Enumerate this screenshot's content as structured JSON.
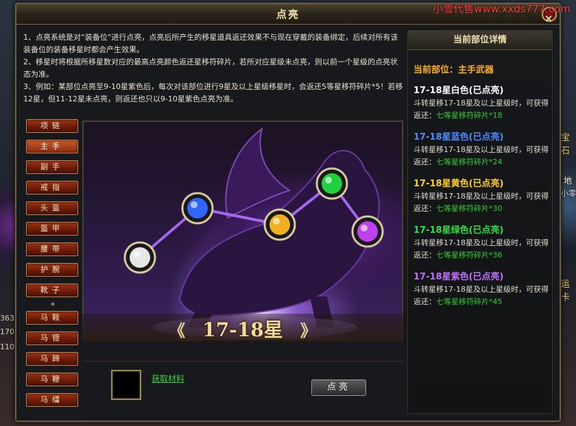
{
  "watermark": "小雪代售www.xxds777.com",
  "window": {
    "title": "点亮",
    "close_label": "×"
  },
  "rules": [
    "1、点亮系统是对“装备位”进行点亮，点亮后所产生的移星道具返还效果不与现在穿戴的装备绑定，后续对所有该装备位的装备移星时都会产生效果。",
    "2、移星时将根据所移星数对应的最高点亮颜色返还星移符碎片，若所对应星级未点亮，则以前一个星级的点亮状态为准。",
    "3、例如：某部位点亮至9-10星紫色后，每次对该部位进行9星及以上星级移星时，会返还5等星移符碎片*5！若移12星，但11-12星未点亮，则返还也只以9-10星紫色点亮为准。"
  ],
  "slots": [
    "项链",
    "主手",
    "副手",
    "戒指",
    "头盔",
    "盔甲",
    "腰带",
    "护腕",
    "靴子",
    "马鞍",
    "马镫",
    "马蹄",
    "马鞭",
    "马缰"
  ],
  "active_slot": "主手",
  "art": {
    "star_label": "17-18星",
    "prev_label": "《",
    "next_label": "》",
    "gem_colors": [
      "#e6e6e6",
      "#2e66ff",
      "#f0b020",
      "#20d040",
      "#c040f0"
    ]
  },
  "material_link": "获取材料",
  "light_button": "点亮",
  "detail": {
    "header": "当前部位详情",
    "current_part": "当前部位：主手武器",
    "tiers": [
      {
        "title": "17-18星白色(已点亮)",
        "color": "#ffffff",
        "desc": "斗转星移17-18星及以上星级时，可获得返还：",
        "item": "七等星移符碎片*18"
      },
      {
        "title": "17-18星蓝色(已点亮)",
        "color": "#4a8cff",
        "desc": "斗转星移17-18星及以上星级时，可获得返还：",
        "item": "七等星移符碎片*24"
      },
      {
        "title": "17-18星黄色(已点亮)",
        "color": "#ffd020",
        "desc": "斗转星移17-18星及以上星级时，可获得返还：",
        "item": "七等星移符碎片*30"
      },
      {
        "title": "17-18星绿色(已点亮)",
        "color": "#30e040",
        "desc": "斗转星移17-18星及以上星级时，可获得返还：",
        "item": "七等星移符碎片*36"
      },
      {
        "title": "17-18星紫色(已点亮)",
        "color": "#c070ff",
        "desc": "斗转星移17-18星及以上星级时，可获得返还：",
        "item": "七等星移符碎片*45"
      }
    ]
  },
  "side": {
    "right_texts": [
      "宝石",
      "地",
      "小零",
      "运卡"
    ],
    "left_nums": [
      "363",
      "170",
      "110"
    ]
  }
}
